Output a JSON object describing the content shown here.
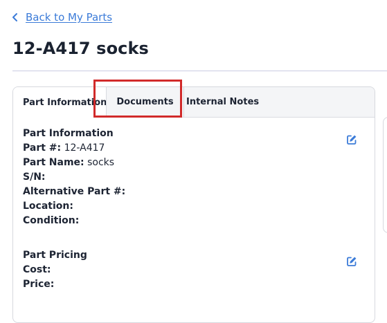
{
  "nav": {
    "back_label": "Back to My Parts"
  },
  "page": {
    "title": "12-A417 socks"
  },
  "tabs": [
    {
      "label": "Part Information",
      "active": true
    },
    {
      "label": "Documents",
      "active": false
    },
    {
      "label": "Internal Notes",
      "active": false
    }
  ],
  "part_info": {
    "heading": "Part Information",
    "part_number_label": "Part #:",
    "part_number_value": "12-A417",
    "part_name_label": "Part Name:",
    "part_name_value": "socks",
    "sn_label": "S/N:",
    "alt_part_label": "Alternative Part #:",
    "location_label": "Location:",
    "condition_label": "Condition:"
  },
  "part_pricing": {
    "heading": "Part Pricing",
    "cost_label": "Cost:",
    "price_label": "Price:"
  },
  "icons": {
    "back": "chevron-left-icon",
    "edit": "edit-icon"
  },
  "colors": {
    "link": "#3b7bd8",
    "highlight": "#d12a2a",
    "text": "#1d2433"
  }
}
